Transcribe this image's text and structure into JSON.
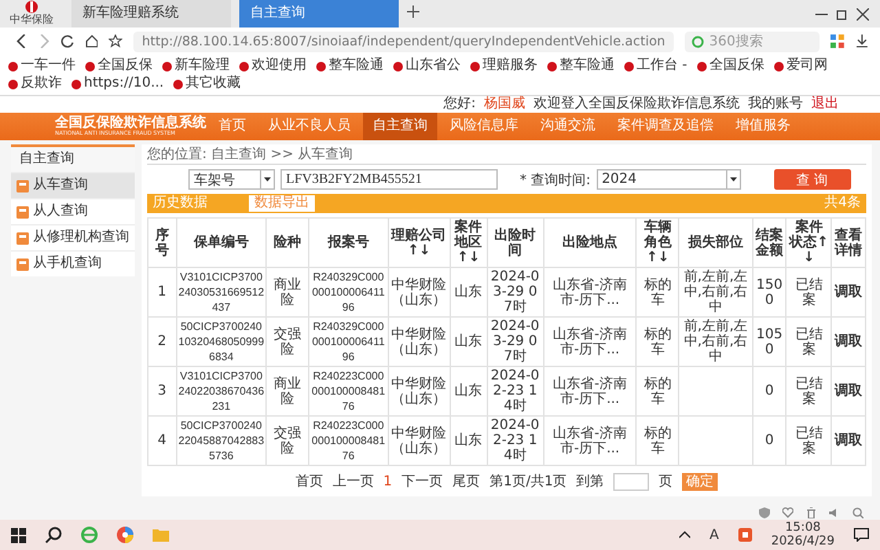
{
  "browser": {
    "logo_text": "中华保险",
    "tabs": [
      {
        "title": "新车险理赔系统",
        "selected": false
      },
      {
        "title": "自主查询",
        "selected": true
      }
    ],
    "url": "http://88.100.14.65:8007/sinoiaaf/independent/queryIndependentVehicle.action",
    "search": {
      "placeholder": "360搜索"
    },
    "bookmarks": [
      "一车一件",
      "全国反保",
      "新车险理",
      "欢迎使用",
      "整车险通",
      "山东省公",
      "理赔服务",
      "整车险通",
      "工作台 -",
      "全国反保",
      "爱司网",
      "反欺诈",
      "https://10...",
      "其它收藏"
    ]
  },
  "page": {
    "header": {
      "logo_title": "全国反保险欺诈信息系统",
      "logo_subtitle": "NATIONAL ANTI INSURANCE FRAUD SYSTEM",
      "greeting": "您好:",
      "user": "杨国威",
      "welcome": "欢迎登入全国反保险欺诈信息系统",
      "account": "我的账号",
      "logout": "退出"
    },
    "nav": [
      {
        "label": "首页",
        "selected": false
      },
      {
        "label": "从业不良人员",
        "selected": false
      },
      {
        "label": "自主查询",
        "selected": true
      },
      {
        "label": "风险信息库",
        "selected": false
      },
      {
        "label": "沟通交流",
        "selected": false
      },
      {
        "label": "案件调查及追偿",
        "selected": false
      },
      {
        "label": "增值服务",
        "selected": false
      }
    ],
    "sidebar": {
      "title": "自主查询",
      "items": [
        {
          "label": "从车查询",
          "selected": true
        },
        {
          "label": "从人查询",
          "selected": false
        },
        {
          "label": "从修理机构查询",
          "selected": false
        },
        {
          "label": "从手机查询",
          "selected": false
        }
      ]
    },
    "breadcrumb": "您的位置: 自主查询 >> 从车查询",
    "search": {
      "field": "车架号",
      "vin": "LFV3B2FY2MB455521",
      "time_label": "* 查询时间:",
      "year": "2024",
      "button": "查 询"
    },
    "results": {
      "title": "历史数据",
      "export_button": "数据导出",
      "count": "共4条",
      "columns": [
        "序号",
        "保单编号",
        "险种",
        "报案号",
        "理赔公司↑↓",
        "案件地区↑↓",
        "出险时间",
        "出险地点",
        "车辆角色↑↓",
        "损失部位",
        "结案金额",
        "案件状态↑↓",
        "查看详情"
      ],
      "rows": [
        [
          "1",
          "V3101CICP370024030531669512437",
          "商业险",
          "R240329C00000010000641196",
          "中华财险（山东）",
          "山东",
          "2024-03-29 07时",
          "山东省-济南市-历下...",
          "标的车",
          "前,左前,左中,右前,右中",
          "1500",
          "已结案",
          "调取"
        ],
        [
          "2",
          "50CICP3700240103204680509996834",
          "交强险",
          "R240329C00000010000641196",
          "中华财险（山东）",
          "山东",
          "2024-03-29 07时",
          "山东省-济南市-历下...",
          "标的车",
          "前,左前,左中,右前,右中",
          "1050",
          "已结案",
          "调取"
        ],
        [
          "3",
          "V3101CICP370024022038670436231",
          "商业险",
          "R240223C00000010000848176",
          "中华财险（山东）",
          "山东",
          "2024-02-23 14时",
          "山东省-济南市-历下...",
          "标的车",
          "",
          "0",
          "已结案",
          "调取"
        ],
        [
          "4",
          "50CICP3700240220458870428835736",
          "交强险",
          "R240223C00000010000848176",
          "中华财险（山东）",
          "山东",
          "2024-02-23 14时",
          "山东省-济南市-历下...",
          "标的车",
          "",
          "0",
          "已结案",
          "调取"
        ]
      ]
    },
    "pagination": {
      "first": "首页",
      "prev": "上一页",
      "current": "1",
      "next": "下一页",
      "last": "尾页",
      "info": "第1页/共1页",
      "goto": "到第",
      "unit": "页",
      "confirm": "确定"
    }
  },
  "taskbar": {
    "ime": "A",
    "time": "15:08",
    "date": "2026/4/29"
  }
}
